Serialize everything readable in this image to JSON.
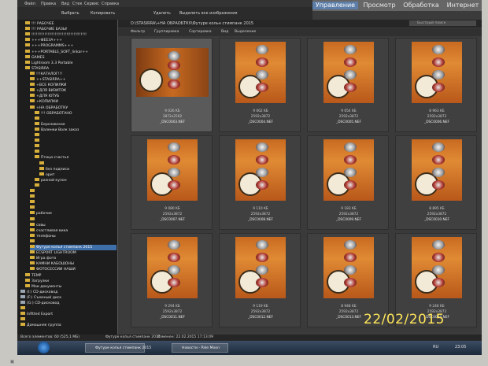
{
  "menu": [
    "Файл",
    "Правка",
    "Вид",
    "Стек",
    "Сервис",
    "Справка"
  ],
  "toolbar": [
    "Выбрать",
    "Копировать",
    "Удалить",
    "Выделить все изображения"
  ],
  "modules": {
    "items": [
      "Управление",
      "Просмотр",
      "Обработка",
      "Интернет"
    ],
    "active": 0
  },
  "tree": [
    {
      "label": "!!! РАБОЧЕЕ",
      "indent": 1
    },
    {
      "label": "!!! РАБОЧИЕ БАЗЫ!",
      "indent": 1
    },
    {
      "label": "!!!!!!!!!!!!!!!!!!!!!!!!!!!!!!!!!!!!!!",
      "indent": 1
    },
    {
      "label": "+++ФЕЕЗА+++",
      "indent": 1
    },
    {
      "label": "+++PROGRAMMS+++",
      "indent": 1
    },
    {
      "label": "+++PORTABLE_SOFT_linkar++",
      "indent": 1
    },
    {
      "label": "GAMES",
      "indent": 1
    },
    {
      "label": "Lightroom 3.3 Portable",
      "indent": 1
    },
    {
      "label": "STASIRRA",
      "indent": 1
    },
    {
      "label": "!!!КАТАЛОГ!!!",
      "indent": 2
    },
    {
      "label": "++STASIRRA++",
      "indent": 2
    },
    {
      "label": "+ВСЕ КОПИЛКИ",
      "indent": 2
    },
    {
      "label": "+ДЛЯ ВИЗИТОК",
      "indent": 2
    },
    {
      "label": "+ДЛЯ ЮТУБ",
      "indent": 2
    },
    {
      "label": "+КОПИЛКИ",
      "indent": 2
    },
    {
      "label": "+НА ОБРАБОТКУ",
      "indent": 2
    },
    {
      "label": "!!! ОБРАБОТАНО",
      "indent": 3
    },
    {
      "label": "",
      "indent": 3
    },
    {
      "label": "Березовская",
      "indent": 3
    },
    {
      "label": "Валенки Волк заказ",
      "indent": 3
    },
    {
      "label": "",
      "indent": 3
    },
    {
      "label": "",
      "indent": 3
    },
    {
      "label": "",
      "indent": 3
    },
    {
      "label": "",
      "indent": 3
    },
    {
      "label": "Птица счастья",
      "indent": 3
    },
    {
      "label": "",
      "indent": 4
    },
    {
      "label": "без подписи",
      "indent": 4
    },
    {
      "label": "орит",
      "indent": 4
    },
    {
      "label": "разной кулон",
      "indent": 3
    },
    {
      "label": "",
      "indent": 3
    },
    {
      "label": "",
      "indent": 2
    },
    {
      "label": "",
      "indent": 2
    },
    {
      "label": "",
      "indent": 2
    },
    {
      "label": "",
      "indent": 2
    },
    {
      "label": "рабочие",
      "indent": 2
    },
    {
      "label": "",
      "indent": 2
    },
    {
      "label": "совы",
      "indent": 2
    },
    {
      "label": "счастливая вика",
      "indent": 2
    },
    {
      "label": "телефоны",
      "indent": 2
    },
    {
      "label": "",
      "indent": 2
    },
    {
      "label": "Футуре копья стимпанк 2015",
      "indent": 2,
      "selected": true
    },
    {
      "label": "ECSPORT LIGHTROOM",
      "indent": 2
    },
    {
      "label": "Игра фото",
      "indent": 2
    },
    {
      "label": "КАМНИ КАБОШОНЫ",
      "indent": 2
    },
    {
      "label": "ФОТОСЕССИИ НАШИ",
      "indent": 2
    },
    {
      "label": "TEMP",
      "indent": 1
    },
    {
      "label": "Загрузки",
      "indent": 1
    },
    {
      "label": "Мои документы",
      "indent": 1
    },
    {
      "label": "(I:) CD-дисковод",
      "indent": 0,
      "drive": true
    },
    {
      "label": "(F:) Съемный диск",
      "indent": 0,
      "drive": true
    },
    {
      "label": "(G:) CD-дисковод",
      "indent": 0,
      "drive": true
    },
    {
      "label": "",
      "indent": 0
    },
    {
      "label": "Infitted Export",
      "indent": 0
    },
    {
      "label": "",
      "indent": 0
    },
    {
      "label": "Домашняя группа",
      "indent": 0
    }
  ],
  "path": "D:\\STASIRRA\\+НА ОБРАОБТКУ\\Футуре кольн стимпанк 2015",
  "search_placeholder": "Быстрый поиск",
  "filters": [
    "Фильтр",
    "Группировка",
    "Сортировка",
    "Вид",
    "Выделение"
  ],
  "thumbnails": [
    {
      "size": "9 026 KБ",
      "dims": "3872x2592",
      "name": "_DSC0003.NEF",
      "wide": true,
      "selected": true
    },
    {
      "size": "9 062 KБ",
      "dims": "2592x3872",
      "name": "_DSC0004.NEF"
    },
    {
      "size": "9 054 KБ",
      "dims": "2592x3872",
      "name": "_DSC0005.NEF"
    },
    {
      "size": "8 963 KБ",
      "dims": "2592x3872",
      "name": "_DSC0006.NEF"
    },
    {
      "size": "9 080 KБ",
      "dims": "2592x3872",
      "name": "_DSC0007.NEF"
    },
    {
      "size": "9 110 KБ",
      "dims": "2592x3872",
      "name": "_DSC0008.NEF"
    },
    {
      "size": "9 183 KБ",
      "dims": "2592x3872",
      "name": "_DSC0009.NEF"
    },
    {
      "size": "8 895 KБ",
      "dims": "2592x3872",
      "name": "_DSC0010.NEF"
    },
    {
      "size": "9 294 KБ",
      "dims": "2592x3872",
      "name": "_DSC0011.NEF"
    },
    {
      "size": "9 119 KБ",
      "dims": "2592x3872",
      "name": "_DSC0012.NEF"
    },
    {
      "size": "8 948 KБ",
      "dims": "2592x3872",
      "name": "_DSC0013.NEF"
    },
    {
      "size": "9 246 KБ",
      "dims": "2592x3872",
      "name": "_DSC0014.NEF"
    }
  ],
  "status": {
    "left": "Всего элементов: 60  (525,1 MБ)",
    "middle": "Футуре копья стимпанк 2015",
    "right": "Изменен: 22.02.2015 17:13:09"
  },
  "taskbar": {
    "tasks": [
      "Футуре копья стимпанк 2015",
      "Новости - Pale Moon"
    ],
    "tray": [
      "RU",
      "23:05"
    ]
  },
  "date_stamp": "22/02/2015"
}
